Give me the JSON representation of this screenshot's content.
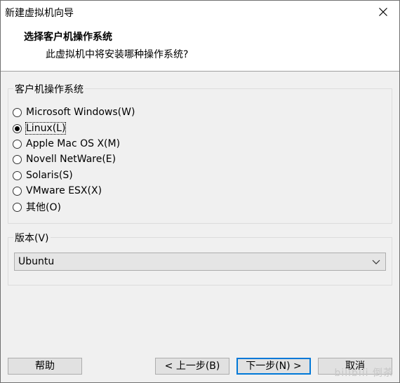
{
  "window": {
    "title": "新建虚拟机向导"
  },
  "header": {
    "title": "选择客户机操作系统",
    "subtitle": "此虚拟机中将安装哪种操作系统?"
  },
  "guest_os": {
    "legend": "客户机操作系统",
    "options": [
      {
        "label": "Microsoft Windows(W)",
        "checked": false
      },
      {
        "label": "Linux(L)",
        "checked": true
      },
      {
        "label": "Apple Mac OS X(M)",
        "checked": false
      },
      {
        "label": "Novell NetWare(E)",
        "checked": false
      },
      {
        "label": "Solaris(S)",
        "checked": false
      },
      {
        "label": "VMware ESX(X)",
        "checked": false
      },
      {
        "label": "其他(O)",
        "checked": false
      }
    ]
  },
  "version": {
    "legend": "版本(V)",
    "selected": "Ubuntu"
  },
  "buttons": {
    "help": "帮助",
    "back": "< 上一步(B)",
    "next": "下一步(N) >",
    "cancel": "取消"
  },
  "watermark": "bilibili 倒茶"
}
